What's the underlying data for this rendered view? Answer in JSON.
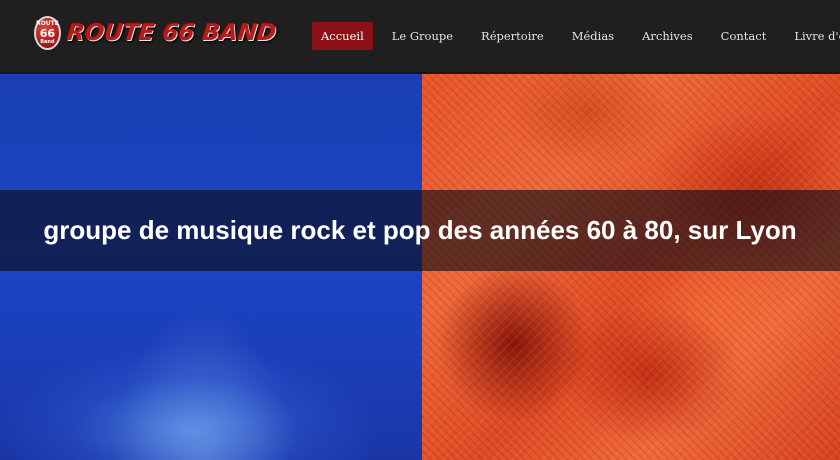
{
  "brand": {
    "logo_text": "ROUTE 66 BAND",
    "badge_top": "ROUTE",
    "badge_number": "66",
    "badge_bottom": "Band"
  },
  "nav": {
    "items": [
      {
        "label": "Accueil",
        "active": true
      },
      {
        "label": "Le Groupe",
        "active": false
      },
      {
        "label": "Répertoire",
        "active": false
      },
      {
        "label": "Médias",
        "active": false
      },
      {
        "label": "Archives",
        "active": false
      },
      {
        "label": "Contact",
        "active": false
      },
      {
        "label": "Livre d'or",
        "active": false
      }
    ]
  },
  "hero": {
    "tagline": "groupe de musique rock et pop des années 60 à 80, sur Lyon"
  },
  "colors": {
    "nav_background": "#1f1f1f",
    "nav_active": "#8b1116",
    "hero_left": "#1c45c4",
    "hero_right": "#f06a3a",
    "band_overlay": "rgba(12,12,22,0.62)"
  }
}
